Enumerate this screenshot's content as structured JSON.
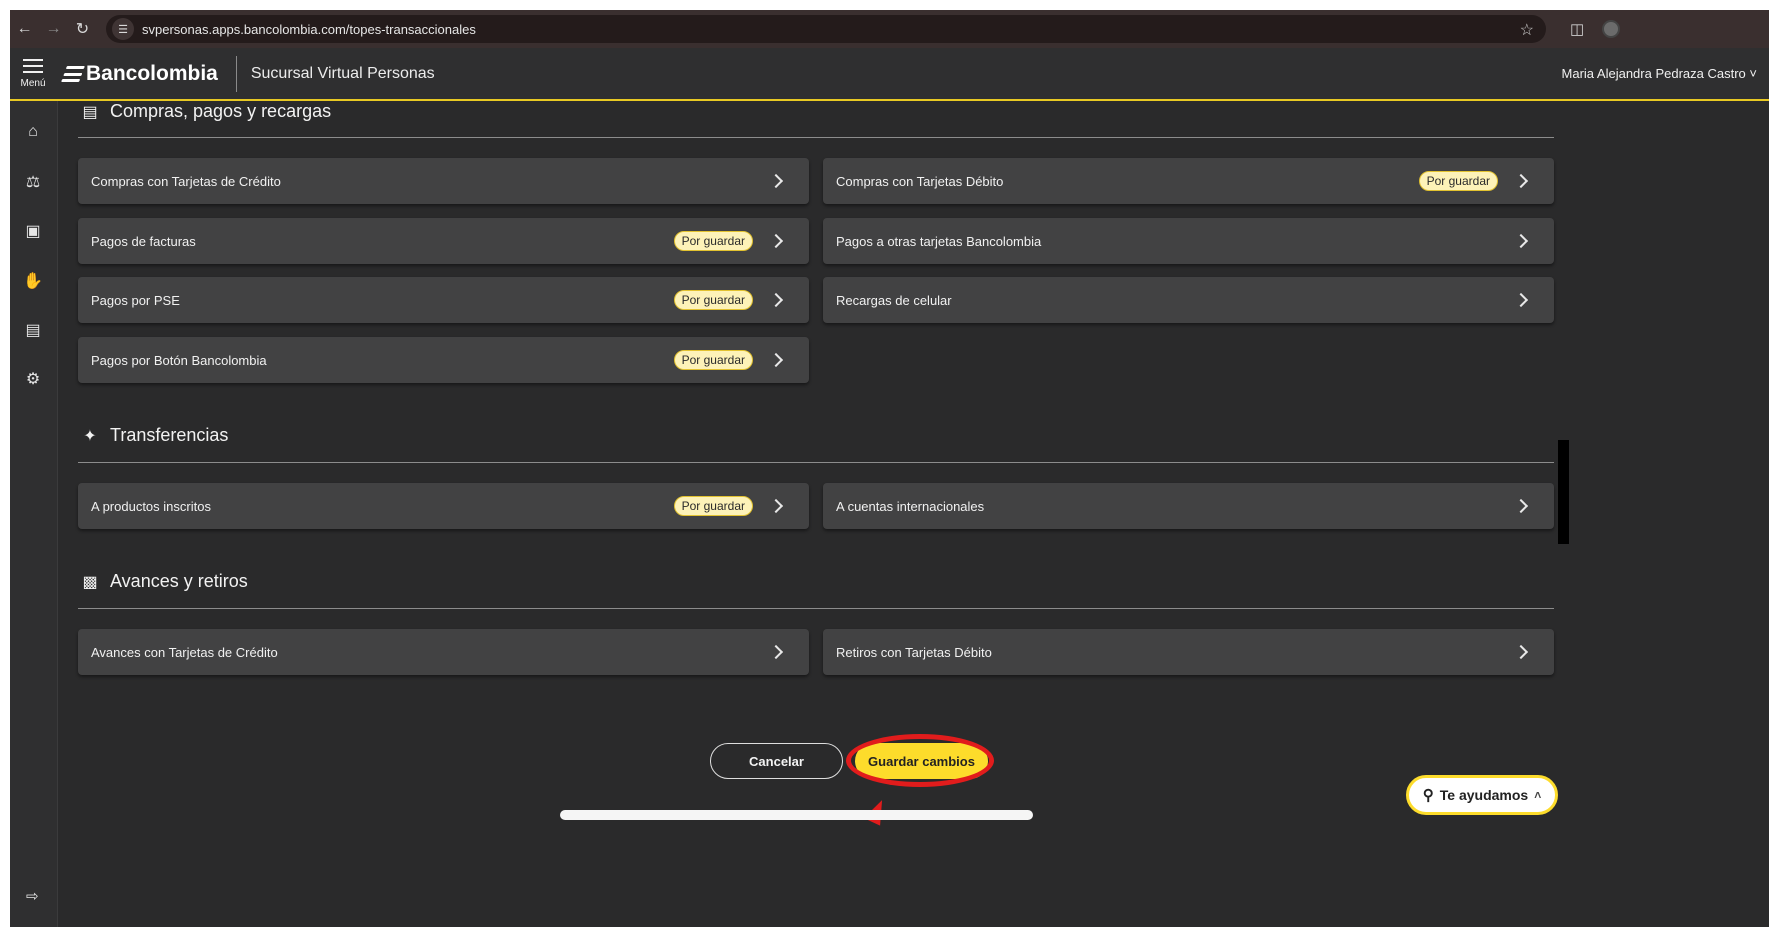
{
  "browser": {
    "url": "svpersonas.apps.bancolombia.com/topes-transaccionales"
  },
  "header": {
    "menu_label": "Menú",
    "brand": "Bancolombia",
    "subtitle": "Sucursal Virtual Personas",
    "user_name": "Maria Alejandra Pedraza Castro"
  },
  "sections": [
    {
      "title": "Compras, pagos y recargas",
      "icon": "money-icon",
      "items": [
        {
          "label": "Compras con Tarjetas de Crédito",
          "badge": ""
        },
        {
          "label": "Compras con Tarjetas Débito",
          "badge": "Por guardar"
        },
        {
          "label": "Pagos de facturas",
          "badge": "Por guardar"
        },
        {
          "label": "Pagos a otras tarjetas Bancolombia",
          "badge": ""
        },
        {
          "label": "Pagos por PSE",
          "badge": "Por guardar"
        },
        {
          "label": "Recargas de celular",
          "badge": ""
        },
        {
          "label": "Pagos por Botón Bancolombia",
          "badge": "Por guardar"
        }
      ]
    },
    {
      "title": "Transferencias",
      "icon": "transfer-icon",
      "items": [
        {
          "label": "A productos inscritos",
          "badge": "Por guardar"
        },
        {
          "label": "A cuentas internacionales",
          "badge": ""
        }
      ]
    },
    {
      "title": "Avances y retiros",
      "icon": "atm-icon",
      "items": [
        {
          "label": "Avances con Tarjetas de Crédito",
          "badge": ""
        },
        {
          "label": "Retiros con Tarjetas Débito",
          "badge": ""
        }
      ]
    }
  ],
  "actions": {
    "cancel": "Cancelar",
    "save": "Guardar cambios"
  },
  "help": {
    "label": "Te ayudamos"
  },
  "colors": {
    "accent": "#fddc2b",
    "annotation": "#e11c1c",
    "background": "#2a2a2b"
  }
}
